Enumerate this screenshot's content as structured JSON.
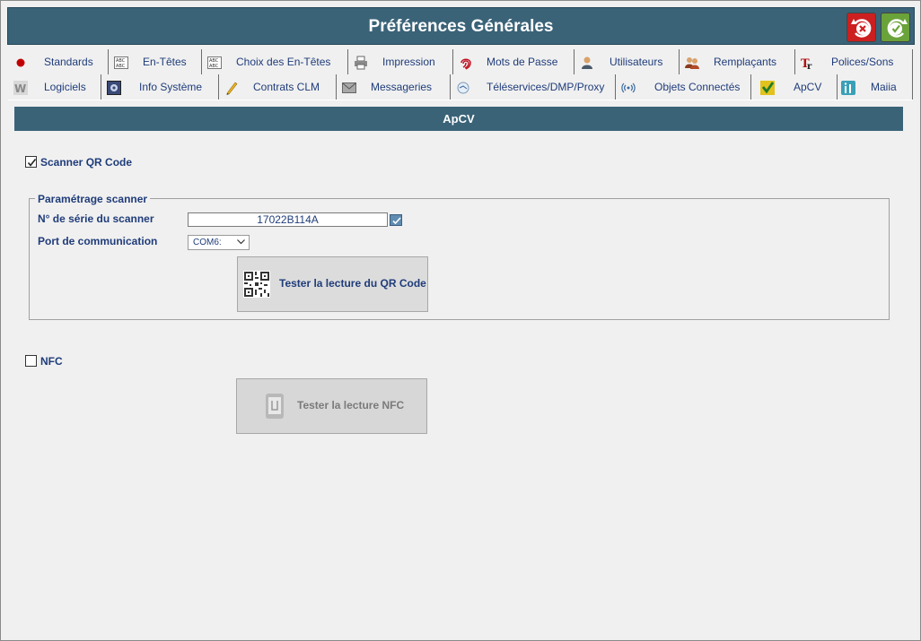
{
  "window": {
    "title": "Préférences Générales"
  },
  "titlebar": {
    "cancel_icon": "cancel-icon",
    "ok_icon": "ok-icon",
    "cancel_color": "#cc1f1f",
    "ok_color": "#6aa33a"
  },
  "tabs": {
    "row1": [
      {
        "label": "Standards",
        "icon": "red-dot-icon"
      },
      {
        "label": "En-Têtes",
        "icon": "text-abc-icon"
      },
      {
        "label": "Choix des En-Têtes",
        "icon": "text-abc-icon"
      },
      {
        "label": "Impression",
        "icon": "printer-icon"
      },
      {
        "label": "Mots de Passe",
        "icon": "fingerprint-icon"
      },
      {
        "label": "Utilisateurs",
        "icon": "user-icon"
      },
      {
        "label": "Remplaçants",
        "icon": "users-icon"
      },
      {
        "label": "Polices/Sons",
        "icon": "font-icon"
      }
    ],
    "row2": [
      {
        "label": "Logiciels",
        "icon": "software-icon"
      },
      {
        "label": "Info Système",
        "icon": "system-icon"
      },
      {
        "label": "Contrats CLM",
        "icon": "pencil-icon"
      },
      {
        "label": "Messageries",
        "icon": "mail-icon"
      },
      {
        "label": "Téléservices/DMP/Proxy",
        "icon": "network-icon"
      },
      {
        "label": "Objets Connectés",
        "icon": "wireless-icon"
      },
      {
        "label": "ApCV",
        "icon": "check-card-icon"
      },
      {
        "label": "Maiia",
        "icon": "maiia-icon"
      }
    ],
    "active": "ApCV"
  },
  "section": {
    "title": "ApCV"
  },
  "qr": {
    "checkbox_label": "Scanner QR Code",
    "checked": true,
    "fieldset_legend": "Paramétrage scanner",
    "serial_label": "N° de série du scanner",
    "serial_value": "17022B114A",
    "port_label": "Port de communication",
    "port_value": "COM6:",
    "test_button": "Tester la lecture du QR Code"
  },
  "nfc": {
    "checkbox_label": "NFC",
    "checked": false,
    "test_button": "Tester la lecture NFC"
  },
  "colors": {
    "accent": "#3a6378",
    "text": "#1f3c7a"
  }
}
